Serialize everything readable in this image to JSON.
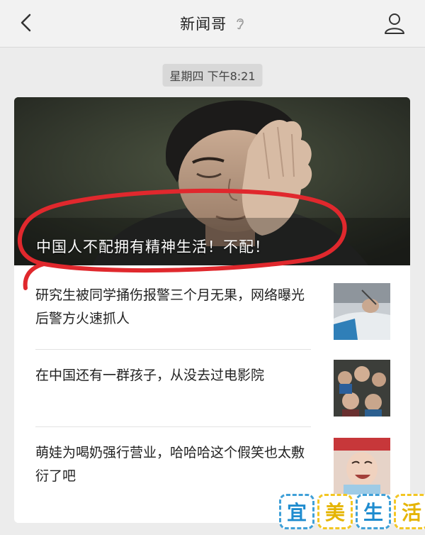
{
  "topbar": {
    "title": "新闻哥",
    "back_icon": "chevron-left-icon",
    "profile_icon": "person-icon",
    "title_badge_icon": "ear-icon"
  },
  "timestamp": "星期四 下午8:21",
  "hero": {
    "title": "中国人不配拥有精神生活！不配！"
  },
  "articles": [
    {
      "title": "研究生被同学捅伤报警三个月无果，网络曝光后警方火速抓人"
    },
    {
      "title": "在中国还有一群孩子，从没去过电影院"
    },
    {
      "title": "萌娃为喝奶强行营业，哈哈哈这个假笑也太敷衍了吧"
    }
  ],
  "watermark": {
    "chars": [
      "宜",
      "美",
      "生",
      "活"
    ]
  },
  "colors": {
    "annotation_red": "#e0282d",
    "watermark_blue": "#1f8ccf",
    "watermark_yellow": "#e5b400"
  }
}
